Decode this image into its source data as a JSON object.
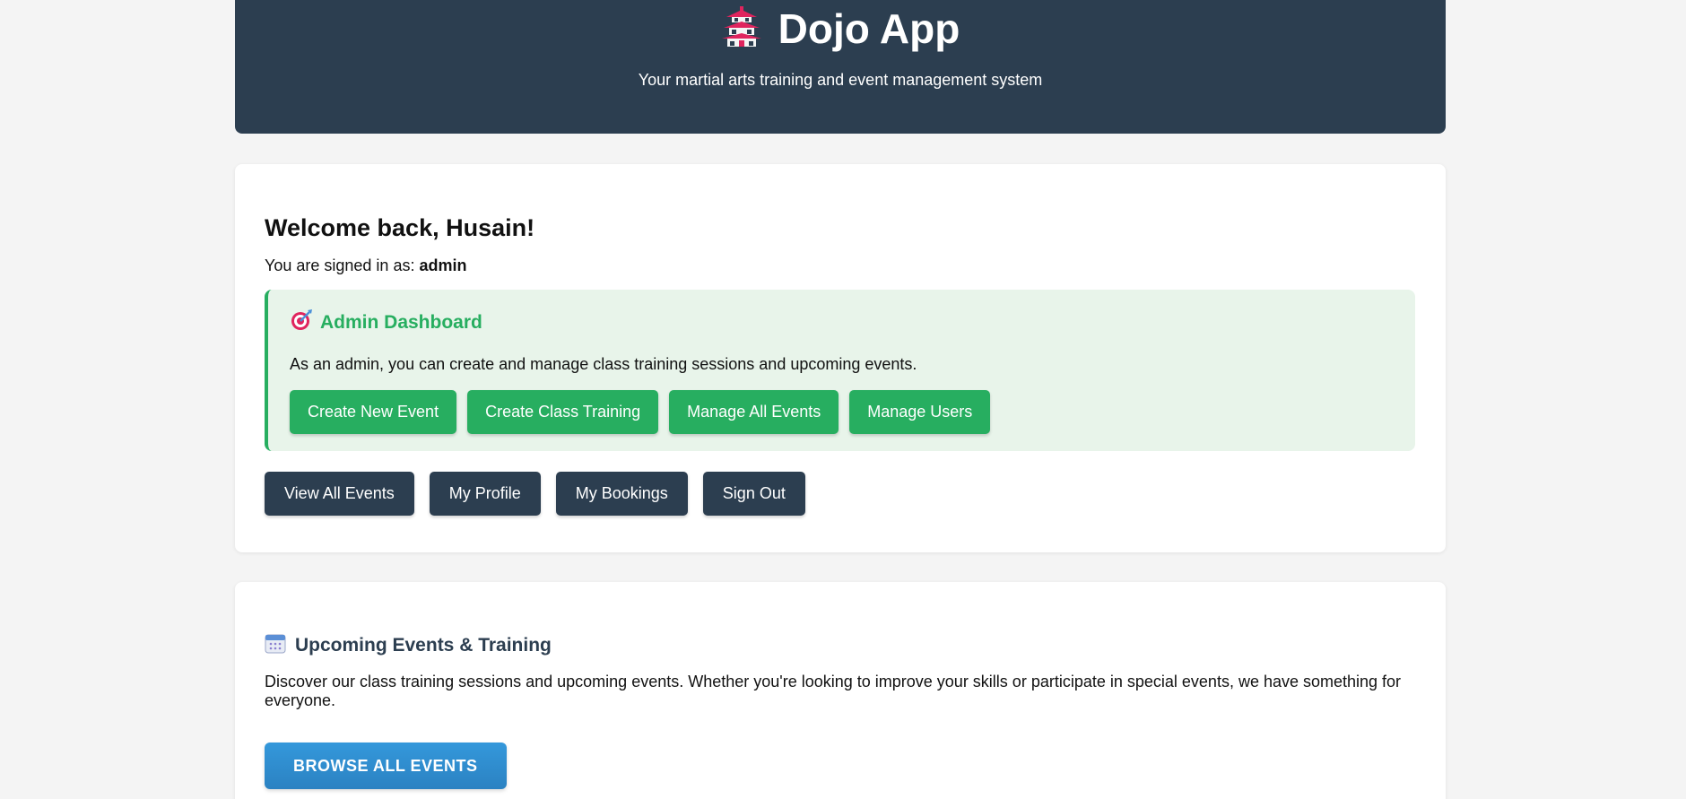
{
  "header": {
    "app_title": "Dojo App",
    "subtitle": "Your martial arts training and event management system",
    "logo_icon": "pagoda-icon"
  },
  "welcome": {
    "heading": "Welcome back, Husain!",
    "signed_in_prefix": "You are signed in as:",
    "role": "admin"
  },
  "admin_dashboard": {
    "icon": "target-icon",
    "title": "Admin Dashboard",
    "description": "As an admin, you can create and manage class training sessions and upcoming events.",
    "buttons": {
      "create_event": "Create New Event",
      "create_training": "Create Class Training",
      "manage_events": "Manage All Events",
      "manage_users": "Manage Users"
    }
  },
  "user_actions": {
    "view_events": "View All Events",
    "my_profile": "My Profile",
    "my_bookings": "My Bookings",
    "sign_out": "Sign Out"
  },
  "events_section": {
    "icon": "calendar-icon",
    "title": "Upcoming Events & Training",
    "description": "Discover our class training sessions and upcoming events. Whether you're looking to improve your skills or participate in special events, we have something for everyone.",
    "browse_button": "BROWSE ALL EVENTS"
  },
  "colors": {
    "header_bg": "#2c3e50",
    "accent_green": "#27ae60",
    "admin_box_bg": "#e8f4ea",
    "browse_blue": "#3498db",
    "page_bg": "#f4f4f4"
  }
}
